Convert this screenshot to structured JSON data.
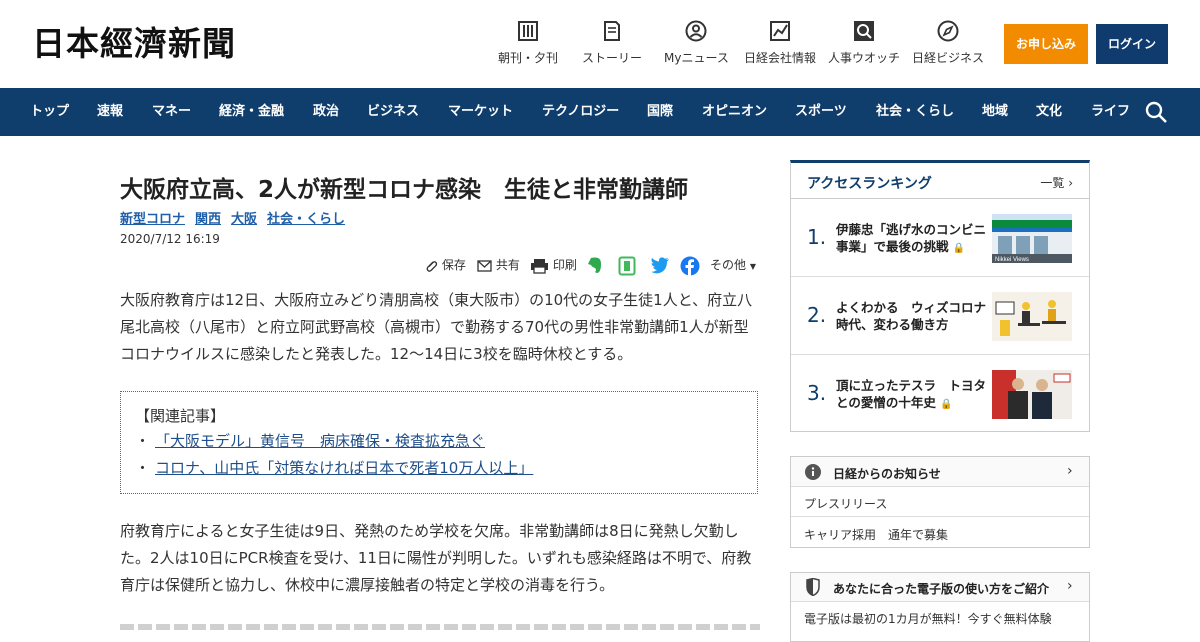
{
  "header": {
    "logo": "日本經濟新聞",
    "nav": [
      {
        "label": "朝刊・夕刊",
        "icon": "newspaper-icon"
      },
      {
        "label": "ストーリー",
        "icon": "story-icon"
      },
      {
        "label": "Myニュース",
        "icon": "user-icon"
      },
      {
        "label": "日経会社情報",
        "icon": "chart-icon"
      },
      {
        "label": "人事ウオッチ",
        "icon": "magnifier-icon"
      },
      {
        "label": "日経ビジネス",
        "icon": "compass-icon"
      }
    ],
    "apply_label": "お申し込み",
    "login_label": "ログイン",
    "colors": {
      "apply": "#f28b00",
      "login": "#0f3b6e"
    }
  },
  "navbar": {
    "items": [
      "トップ",
      "速報",
      "マネー",
      "経済・金融",
      "政治",
      "ビジネス",
      "マーケット",
      "テクノロジー",
      "国際",
      "オピニオン",
      "スポーツ",
      "社会・くらし",
      "地域",
      "文化",
      "ライフ"
    ],
    "color": "#0f3d6c"
  },
  "article": {
    "title": "大阪府立高、2人が新型コロナ感染　生徒と非常勤講師",
    "tags": [
      "新型コロナ",
      "関西",
      "大阪",
      "社会・くらし"
    ],
    "date": "2020/7/12 16:19",
    "tools": {
      "save": "保存",
      "share": "共有",
      "print": "印刷",
      "more": "その他"
    },
    "para1": "大阪府教育庁は12日、大阪府立みどり清朋高校（東大阪市）の10代の女子生徒1人と、府立八尾北高校（八尾市）と府立阿武野高校（高槻市）で勤務する70代の男性非常勤講師1人が新型コロナウイルスに感染したと発表した。12～14日に3校を臨時休校とする。",
    "related": {
      "heading": "【関連記事】",
      "links": [
        "「大阪モデル」黄信号　病床確保・検査拡充急ぐ",
        "コロナ、山中氏「対策なければ日本で死者10万人以上」"
      ]
    },
    "para2": "府教育庁によると女子生徒は9日、発熱のため学校を欠席。非常勤講師は8日に発熱し欠勤した。2人は10日にPCR検査を受け、11日に陽性が判明した。いずれも感染経路は不明で、府教育庁は保健所と協力し、休校中に濃厚接触者の特定と学校の消毒を行う。"
  },
  "sidebar": {
    "ranking": {
      "title": "アクセスランキング",
      "more": "一覧",
      "items": [
        {
          "num": "1.",
          "text": "伊藤忠「逃げ水のコンビニ事業」で最後の挑戦"
        },
        {
          "num": "2.",
          "text": "よくわかる　ウィズコロナ時代、変わる働き方"
        },
        {
          "num": "3.",
          "text": "頂に立ったテスラ　トヨタとの愛憎の十年史"
        }
      ]
    },
    "info": {
      "title": "日経からのお知らせ",
      "rows": [
        "プレスリリース",
        "キャリア採用　通年で募集"
      ]
    },
    "guide": {
      "title": "あなたに合った電子版の使い方をご紹介",
      "text": "電子版は最初の1カ月が無料！今すぐ無料体験"
    }
  }
}
